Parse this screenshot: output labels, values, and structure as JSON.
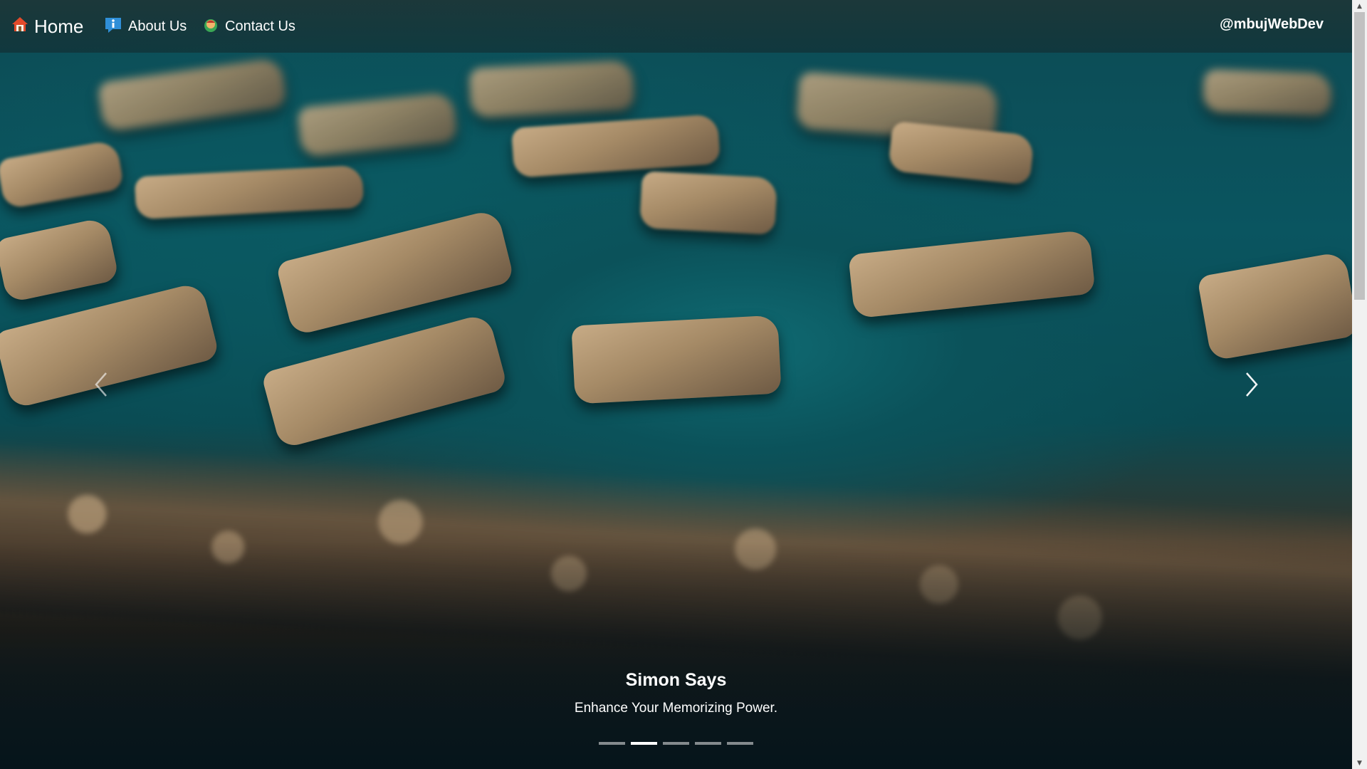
{
  "navbar": {
    "home_label": "Home",
    "about_label": "About Us",
    "contact_label": "Contact Us",
    "brand": "@mbujWebDev",
    "icons": {
      "home": "house-icon",
      "about": "info-icon",
      "contact": "contact-person-icon"
    }
  },
  "carousel": {
    "caption_title": "Simon Says",
    "caption_text": "Enhance Your Memorizing Power.",
    "slide_count": 5,
    "active_slide": 2,
    "prev_icon": "chevron-left-icon",
    "next_icon": "chevron-right-icon",
    "background_image": "teal felt with jigsaw puzzle pieces"
  },
  "colors": {
    "nav_text": "#ffffff",
    "teal": "#0f6b73",
    "puzzle_tan": "#c7ab86"
  }
}
